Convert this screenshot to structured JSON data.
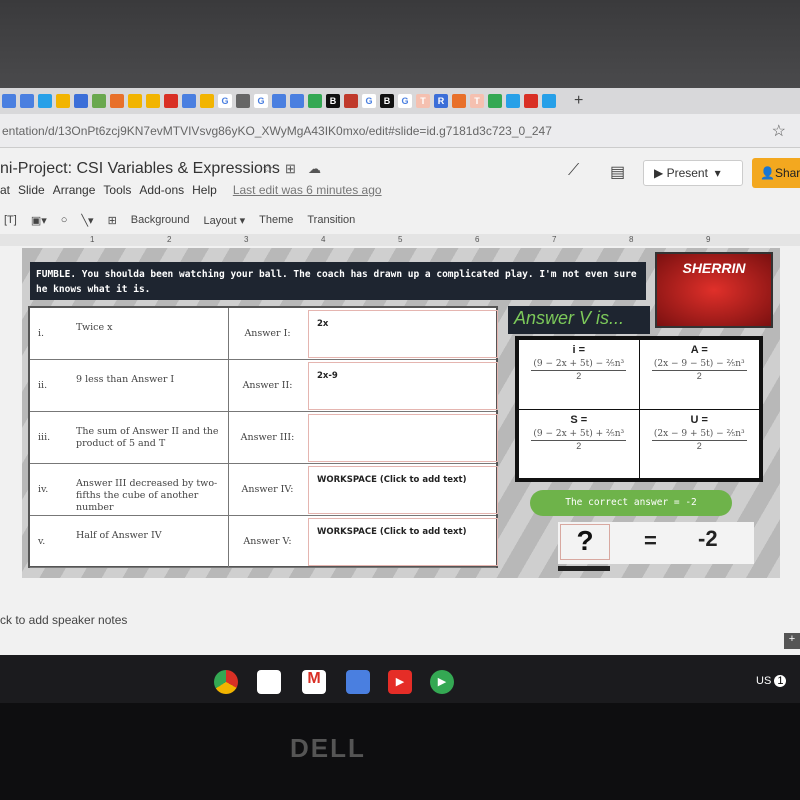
{
  "browser": {
    "url": "entation/d/13OnPt6zcj9KN7evMTVIVsvg86yKO_XWyMgA43IK0mxo/edit#slide=id.g7181d3c723_0_247",
    "new_tab": "+",
    "tab_icons": [
      {
        "c": "#4a7fe0",
        "t": ""
      },
      {
        "c": "#4a7fe0",
        "t": ""
      },
      {
        "c": "#27a0e8",
        "t": ""
      },
      {
        "c": "#f2b400",
        "t": ""
      },
      {
        "c": "#3b6ed8",
        "t": ""
      },
      {
        "c": "#6aa84f",
        "t": ""
      },
      {
        "c": "#e8702a",
        "t": ""
      },
      {
        "c": "#f2b400",
        "t": ""
      },
      {
        "c": "#f2b400",
        "t": ""
      },
      {
        "c": "#d93025",
        "t": ""
      },
      {
        "c": "#4a7fe0",
        "t": ""
      },
      {
        "c": "#f2b400",
        "t": ""
      },
      {
        "c": "#ffffff",
        "t": "G"
      },
      {
        "c": "#666",
        "t": ""
      },
      {
        "c": "#ffffff",
        "t": "G"
      },
      {
        "c": "#4a7fe0",
        "t": ""
      },
      {
        "c": "#4a7fe0",
        "t": ""
      },
      {
        "c": "#34a853",
        "t": ""
      },
      {
        "c": "#111",
        "t": "B"
      },
      {
        "c": "#c0392b",
        "t": ""
      },
      {
        "c": "#ffffff",
        "t": "G"
      },
      {
        "c": "#111",
        "t": "B"
      },
      {
        "c": "#ffffff",
        "t": "G"
      },
      {
        "c": "#f5c0b0",
        "t": "T"
      },
      {
        "c": "#3b6ed8",
        "t": "R"
      },
      {
        "c": "#e8702a",
        "t": ""
      },
      {
        "c": "#f5c0b0",
        "t": "T"
      },
      {
        "c": "#34a853",
        "t": ""
      },
      {
        "c": "#27a0e8",
        "t": ""
      },
      {
        "c": "#d93025",
        "t": ""
      },
      {
        "c": "#27a0e8",
        "t": ""
      }
    ]
  },
  "app": {
    "title": "ni-Project: CSI Variables & Expressions",
    "menu": [
      "at",
      "Slide",
      "Arrange",
      "Tools",
      "Add-ons",
      "Help"
    ],
    "last_edit": "Last edit was 6 minutes ago",
    "present": "Present",
    "share": "Shar",
    "toolbar": [
      "Background",
      "Layout ▾",
      "Theme",
      "Transition"
    ],
    "ruler": [
      "1",
      "2",
      "3",
      "4",
      "5",
      "6",
      "7",
      "8",
      "9"
    ]
  },
  "slide": {
    "banner": "FUMBLE. You shoulda been watching your ball. The coach has drawn up a complicated play. I'm not even sure he knows what it is.",
    "logo": "SHERRIN",
    "rows": [
      {
        "num": "i.",
        "desc": "Twice x",
        "label": "Answer I:",
        "answer": "2x"
      },
      {
        "num": "ii.",
        "desc": "9 less than Answer I",
        "label": "Answer II:",
        "answer": "2x-9"
      },
      {
        "num": "iii.",
        "desc": "The sum of Answer II and the product of 5 and T",
        "label": "Answer III:",
        "answer": ""
      },
      {
        "num": "iv.",
        "desc": "Answer III decreased by two-fifths the cube of another number",
        "label": "Answer IV:",
        "answer": "WORKSPACE (Click to add text)"
      },
      {
        "num": "v.",
        "desc": "Half of Answer IV",
        "label": "Answer V:",
        "answer": "WORKSPACE (Click to add text)"
      }
    ],
    "answer_v_title": "Answer V is...",
    "options": [
      {
        "var": "i =",
        "num": "(9 − 2x + 5t) − ⅖n³",
        "den": "2"
      },
      {
        "var": "A =",
        "num": "(2x − 9 − 5t) − ⅖n³",
        "den": "2"
      },
      {
        "var": "S =",
        "num": "(9 − 2x + 5t) + ⅖n³",
        "den": "2"
      },
      {
        "var": "U =",
        "num": "(2x − 9 + 5t) − ⅖n³",
        "den": "2"
      }
    ],
    "correct": "The correct answer = -2",
    "question": "?",
    "equals": "=",
    "result": "-2"
  },
  "notes": "ck to add speaker notes",
  "taskbar": {
    "locale": "US",
    "badge": "1"
  },
  "bezel": {
    "brand": "DELL"
  }
}
